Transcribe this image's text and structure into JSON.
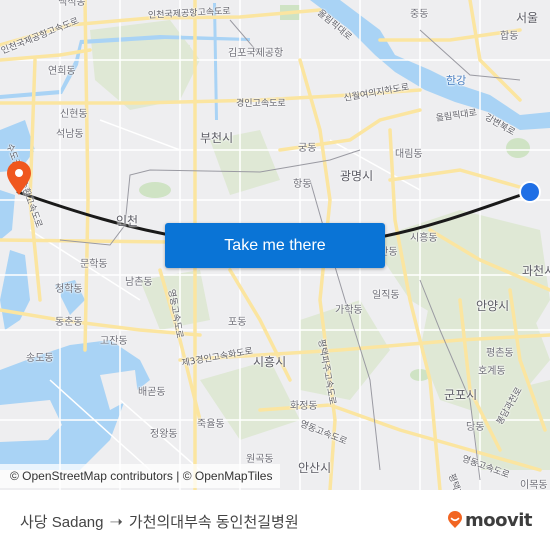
{
  "map": {
    "colors": {
      "land": "#eeeef0",
      "water": "#a9d3f5",
      "park": "#cfe3c4",
      "forest": "#dfe8d5",
      "road_major": "#fbe5a0",
      "road_minor": "#ffffff",
      "route_line": "#1a1a1a",
      "origin_dot": "#1f6fe5",
      "destination_pin": "#f0571e"
    },
    "labels": [
      {
        "text": "백석동",
        "kind": "district"
      },
      {
        "text": "인천국제공항고속도로",
        "kind": "road"
      },
      {
        "text": "인천국제공항고속도로",
        "kind": "road"
      },
      {
        "text": "올림픽대로",
        "kind": "road"
      },
      {
        "text": "중동",
        "kind": "district"
      },
      {
        "text": "서울",
        "kind": "city"
      },
      {
        "text": "합동",
        "kind": "district"
      },
      {
        "text": "김포국제공항",
        "kind": "district"
      },
      {
        "text": "연희동",
        "kind": "district"
      },
      {
        "text": "한강",
        "kind": "river"
      },
      {
        "text": "신현동",
        "kind": "district"
      },
      {
        "text": "경인고속도로",
        "kind": "road"
      },
      {
        "text": "신월여의지하도로",
        "kind": "road"
      },
      {
        "text": "올림픽대로",
        "kind": "road"
      },
      {
        "text": "강변북로",
        "kind": "road"
      },
      {
        "text": "석남동",
        "kind": "district"
      },
      {
        "text": "부천시",
        "kind": "city"
      },
      {
        "text": "궁동",
        "kind": "district"
      },
      {
        "text": "대림동",
        "kind": "district"
      },
      {
        "text": "수도권제1순환고속도로",
        "kind": "road"
      },
      {
        "text": "항동",
        "kind": "district"
      },
      {
        "text": "광명시",
        "kind": "city"
      },
      {
        "text": "인천",
        "kind": "city"
      },
      {
        "text": "시흥동",
        "kind": "district"
      },
      {
        "text": "문학동",
        "kind": "district"
      },
      {
        "text": "독산동",
        "kind": "district"
      },
      {
        "text": "과천시",
        "kind": "city"
      },
      {
        "text": "남촌동",
        "kind": "district"
      },
      {
        "text": "청학동",
        "kind": "district"
      },
      {
        "text": "영동고속도로",
        "kind": "road"
      },
      {
        "text": "일직동",
        "kind": "district"
      },
      {
        "text": "가학동",
        "kind": "district"
      },
      {
        "text": "동춘동",
        "kind": "district"
      },
      {
        "text": "포동",
        "kind": "district"
      },
      {
        "text": "안양시",
        "kind": "city"
      },
      {
        "text": "고잔동",
        "kind": "district"
      },
      {
        "text": "평촌동",
        "kind": "district"
      },
      {
        "text": "평택파주고속도로",
        "kind": "road"
      },
      {
        "text": "송도동",
        "kind": "district"
      },
      {
        "text": "제3경인고속화도로",
        "kind": "road"
      },
      {
        "text": "시흥시",
        "kind": "city"
      },
      {
        "text": "호계동",
        "kind": "district"
      },
      {
        "text": "배곧동",
        "kind": "district"
      },
      {
        "text": "군포시",
        "kind": "city"
      },
      {
        "text": "화정동",
        "kind": "district"
      },
      {
        "text": "죽율동",
        "kind": "district"
      },
      {
        "text": "영동고속도로",
        "kind": "road"
      },
      {
        "text": "당동",
        "kind": "district"
      },
      {
        "text": "정왕동",
        "kind": "district"
      },
      {
        "text": "봉담과천로",
        "kind": "road"
      },
      {
        "text": "원곡동",
        "kind": "district"
      },
      {
        "text": "안산시",
        "kind": "city"
      },
      {
        "text": "영동고속도로",
        "kind": "road"
      },
      {
        "text": "평택파주고속도로",
        "kind": "road"
      },
      {
        "text": "이목동",
        "kind": "district"
      }
    ],
    "origin_marker": {
      "name": "사당 Sadang",
      "icon": "origin-dot-icon"
    },
    "destination_marker": {
      "name": "가천의대부속 동인천길병원",
      "icon": "map-pin-icon"
    },
    "attribution": "© OpenStreetMap contributors | © OpenMapTiles",
    "cta_label": "Take me there"
  },
  "footer": {
    "origin": "사당 Sadang",
    "arrow_icon": "arrow-right-icon",
    "destination": "가천의대부속 동인천길병원",
    "brand": "moovit",
    "brand_color": "#f26522"
  }
}
